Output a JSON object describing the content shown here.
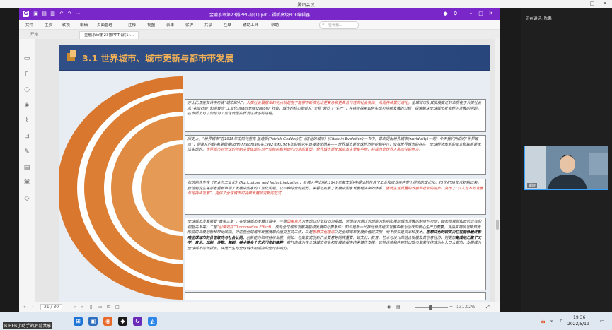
{
  "meeting": {
    "title": "腾讯会议",
    "min_glyph": "—",
    "max_glyph": "□",
    "close_glyph": "✕"
  },
  "app": {
    "window_title": "金融系审第23排PPT-部(1).pdf - 福昕高级PDF编辑器",
    "menus": [
      "文件",
      "主页",
      "转换",
      "编辑",
      "页面管理",
      "注释",
      "视图",
      "表单",
      "保护",
      "共享",
      "互联",
      "辅助工具",
      "帮助"
    ],
    "search_placeholder": "告诉我..."
  },
  "tabs": [
    {
      "label": "开始"
    },
    {
      "label": "金融系审第23排PPT-部(1)..."
    }
  ],
  "slide": {
    "title": "3.1 世界城市、城市更新与都市带发展",
    "boxes": [
      {
        "segments": [
          {
            "t": "亦士比亚在其诗中所说“城市即人”。",
            "s": ""
          },
          {
            "t": "人类社会最根本的特点就是在于能够不断演化出更复杂和更具合作性的社会实体，从而持续繁衍进化。",
            "s": "red"
          },
          {
            "t": "全球城市及其发展变迁的本质在于人类社会从“农业社会”知道转向“工业化(industrialization)”社会，城市的核心职能从“交易”转向了“生产”，并持续探索如何实现可持续发展的过程，探索解决全球城市社会经济发展的问题，在本质上可以归结为工业化转型实质发达状态的进程。",
            "s": ""
          }
        ]
      },
      {
        "segments": [
          {
            "t": "历史上，“世界城市”在1915年由帕特里克·盖迪斯(Patrick Geddes)在《进化的城市》(Cities in Evolution)一书中，首次提出世界城市(world city)一词；今天我们所说的“世界城市”，则是从约翰·弗里德曼(John Friedman)在1982年和1986年的研究中直接演化而来——世界城市是全球经济的控制中心，没有世界城市的存在，全球经济体系的建立和联系是无法实现的。",
            "s": ""
          },
          {
            "t": "世界城市对全球的控制主要体现在对产业结构和劳动力市场的重塑，世界城市是全球资本主要集中地，并成为全世界人民向往的地方。",
            "s": "red"
          }
        ]
      },
      {
        "segments": [
          {
            "t": "张培刚先生在《农业与工业化》(Agriculture and Industrialization，哈佛大学出版社1949年英文版)中提出的包含了工业和农业在内整个经济的现代化。20世纪80年代初期以来，张培刚先生等学者重新审视了发展中国家的工业化问题，以一种综合的视野，来看与拓展了发展中国家发展经济学的体系，",
            "s": ""
          },
          {
            "t": "强调生活质量的改善和社会的进步，突出了“以人为本的发展与可持续发展”，提供了全球城市可持续发展研究新的范式。",
            "s": "red"
          }
        ]
      },
      {
        "segments": [
          {
            "t": "全球城市发展需要“黄金三角”，在全球城市发展过程中，一是",
            "s": ""
          },
          {
            "t": "国家意志",
            "s": "red"
          },
          {
            "t": "力表现以价值取向为基础，凭借权力通过治理能力影响和推动城市发展的制度与行动，如市场规则和政府公权的相互关系等；二是",
            "s": ""
          },
          {
            "t": "“引擎效应”(Locomotive Effect)",
            "s": "red"
          },
          {
            "t": "，成为全球城市发展高能级发展的必要条件；知识是新一代推动世界经济发展中最为活跃的核心生产力要素，其由高端研发集聚而形成的次级创新和带动效应。对这些全球城市发展展现价值交互式工作，三是",
            "s": ""
          },
          {
            "t": "思想文化理念",
            "s": "red"
          },
          {
            "t": "决定全球城市发展价值链文明，而不仅仅是资本和技术。",
            "s": ""
          },
          {
            "t": "思想文化的软实力往往能够最终影响全球城市的价值取向与社会认同、",
            "s": "bold"
          },
          {
            "t": "创新能力和可持续发展，例如：与集聚式创新产业要素等同样重要，如文化、教育、艺术与设计的结合发展及其创意经济，则更加",
            "s": ""
          },
          {
            "t": "集成地汇聚了文学、音乐、戏剧、诗歌、舞蹈、美术等多个艺术门类的精粹",
            "s": "bold"
          },
          {
            "t": "，被打造成为在全球城市竞争和发展进程中的关键性支撑，这些设施和内容的出现与繁荣往往成为从人口大都市，发展成为全球城市的转折点。从而产生与全球城市相适应的全球影响力。",
            "s": ""
          }
        ]
      }
    ]
  },
  "statusbar": {
    "page": "21 / 30",
    "zoom": "131.02%"
  },
  "panel": {
    "speaker": "正在讲话: 陈鹏",
    "video_name": "谢晓"
  },
  "taskbar": {
    "share_note": "R HFR小助手的屏幕共享",
    "clock_time": "19:36",
    "clock_date": "2022/5/19",
    "lang": "中"
  },
  "colors": {
    "accent": "#7a27c9",
    "slide_bg": "#233d6f",
    "title": "#f0b056",
    "arc": "#d9772e"
  }
}
